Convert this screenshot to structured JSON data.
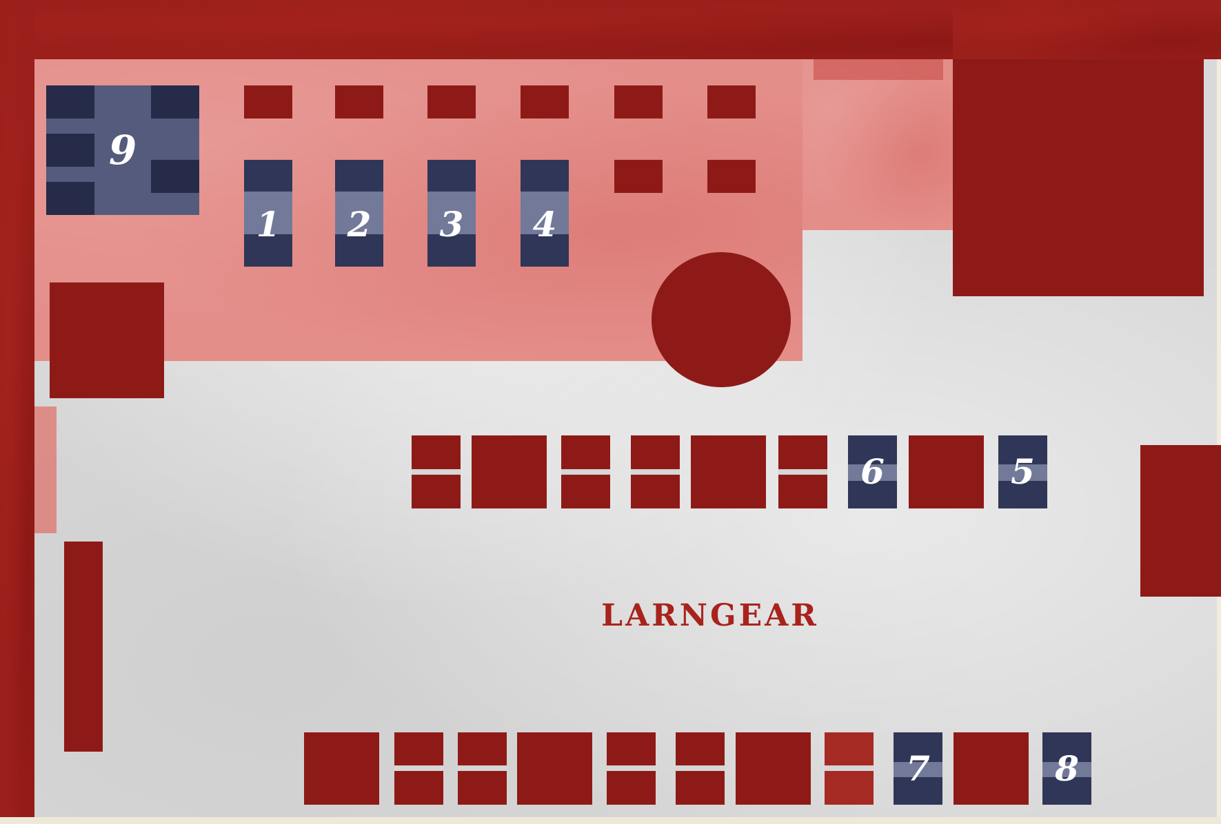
{
  "map": {
    "area_label": "LARNGEAR",
    "colors": {
      "wall": "#8e1a17",
      "zone": "#e48e8a",
      "floor": "#d9d9d9",
      "slot": "#2f3657",
      "label": "#a8231c"
    },
    "slots": [
      {
        "id": "slot-1",
        "label": "1"
      },
      {
        "id": "slot-2",
        "label": "2"
      },
      {
        "id": "slot-3",
        "label": "3"
      },
      {
        "id": "slot-4",
        "label": "4"
      },
      {
        "id": "slot-5",
        "label": "5"
      },
      {
        "id": "slot-6",
        "label": "6"
      },
      {
        "id": "slot-7",
        "label": "7"
      },
      {
        "id": "slot-8",
        "label": "8"
      },
      {
        "id": "slot-9",
        "label": "9"
      }
    ]
  }
}
